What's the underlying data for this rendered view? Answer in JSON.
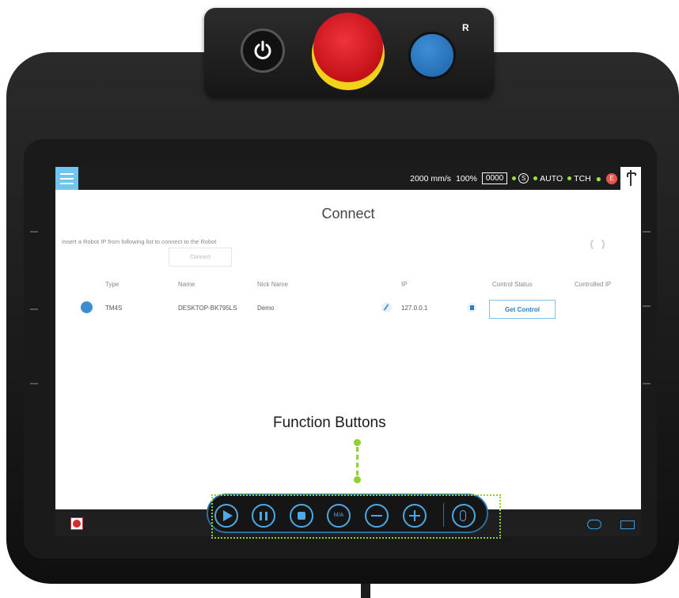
{
  "hardware": {
    "r_label": "R"
  },
  "topbar": {
    "speed": "2000 mm/s",
    "percent": "100%",
    "speed_box": "0000",
    "s_symbol": "S",
    "mode_auto": "AUTO",
    "mode_tch": "TCH",
    "e_badge": "E"
  },
  "page": {
    "title": "Connect",
    "hint": "Insert a Robot IP from following list to connect to the Robot",
    "connect_button": "Connect"
  },
  "table": {
    "headers": [
      "Type",
      "Name",
      "Nick Name",
      "IP",
      "Control Status",
      "Controlled IP"
    ],
    "rows": [
      {
        "type": "TM4S",
        "name": "DESKTOP-BK795LS",
        "nick_name": "Demo",
        "ip": "127.0.0.1",
        "control_button": "Get Control"
      }
    ]
  },
  "function_bar": {
    "ma_label": "M/A"
  },
  "annotation": {
    "label": "Function Buttons"
  },
  "colors": {
    "accent_blue": "#4fa8e6",
    "annotation_green": "#8fd130",
    "estop_red": "#d41e25",
    "estop_yellow": "#f2d21a"
  }
}
